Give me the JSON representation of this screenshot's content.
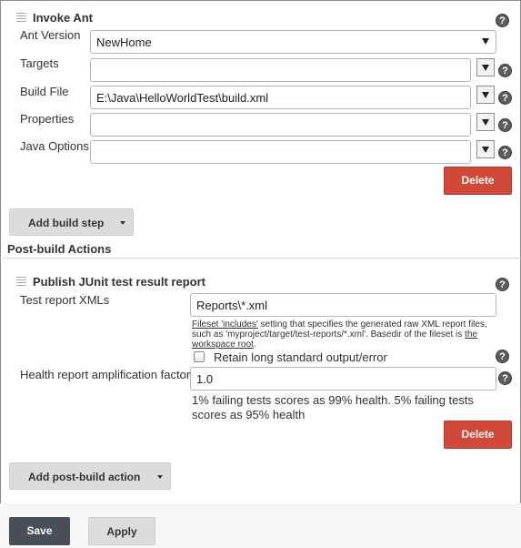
{
  "invoke_ant": {
    "title": "Invoke Ant",
    "fields": {
      "ant_version": {
        "label": "Ant Version",
        "value": "NewHome"
      },
      "targets": {
        "label": "Targets",
        "value": ""
      },
      "build_file": {
        "label": "Build File",
        "value": "E:\\Java\\HelloWorldTest\\build.xml"
      },
      "properties": {
        "label": "Properties",
        "value": ""
      },
      "java_options": {
        "label": "Java Options",
        "value": ""
      }
    },
    "delete_label": "Delete"
  },
  "add_build_step_label": "Add build step",
  "post_build": {
    "section_title": "Post-build Actions",
    "junit": {
      "title": "Publish JUnit test result report",
      "test_report_label": "Test report XMLs",
      "test_report_value": "Reports\\*.xml",
      "hint": {
        "fileset_link": "Fileset 'includes'",
        "text1": " setting that specifies the generated raw XML report files,",
        "text2": "such as 'myproject/target/test-reports/*.xml'. Basedir of the fileset is ",
        "basedir_link_a": "the",
        "basedir_link_b": "workspace root",
        "end": "."
      },
      "retain_label": "Retain long standard output/error",
      "health_label": "Health report amplification factor",
      "health_value": "1.0",
      "health_desc_line1": "1% failing tests scores as 99% health. 5% failing tests",
      "health_desc_line2": "scores as 95% health",
      "delete_label": "Delete"
    },
    "add_action_label": "Add post-build action"
  },
  "footer": {
    "save_label": "Save",
    "apply_label": "Apply"
  },
  "help_glyph": "?",
  "colors": {
    "delete_red": "#d24939",
    "save_dark": "#4a4f57"
  }
}
